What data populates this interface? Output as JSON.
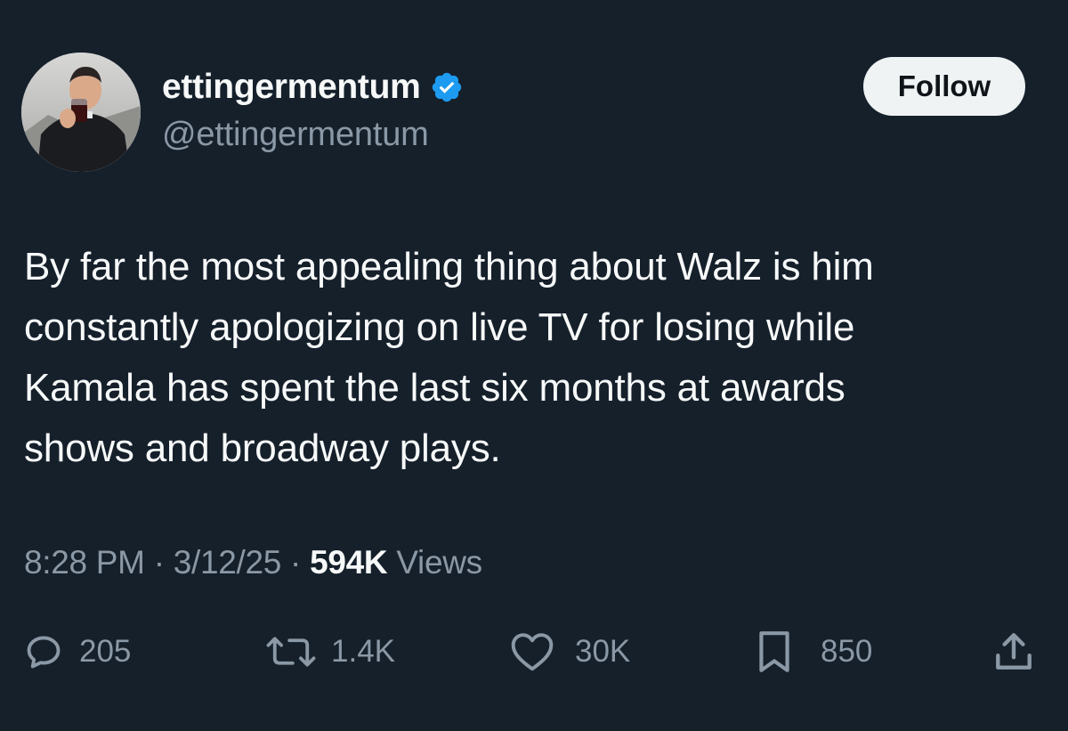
{
  "author": {
    "display_name": "ettingermentum",
    "handle": "@ettingermentum",
    "verified": true
  },
  "follow_button": {
    "label": "Follow"
  },
  "tweet": {
    "text": "By far the most appealing thing about Walz is him\nconstantly apologizing on live TV for losing while\nKamala has spent the last six months at awards\nshows and broadway plays.",
    "time": "8:28 PM",
    "separator": "·",
    "date": "3/12/25",
    "views_count": "594K",
    "views_label": "Views"
  },
  "actions": {
    "reply_count": "205",
    "retweet_count": "1.4K",
    "like_count": "30K",
    "bookmark_count": "850"
  },
  "colors": {
    "background": "#15202b",
    "primary_text": "#f7f9f9",
    "secondary_text": "#8b98a5",
    "verified_badge": "#1d9bf0",
    "follow_button_bg": "#eff3f4"
  }
}
